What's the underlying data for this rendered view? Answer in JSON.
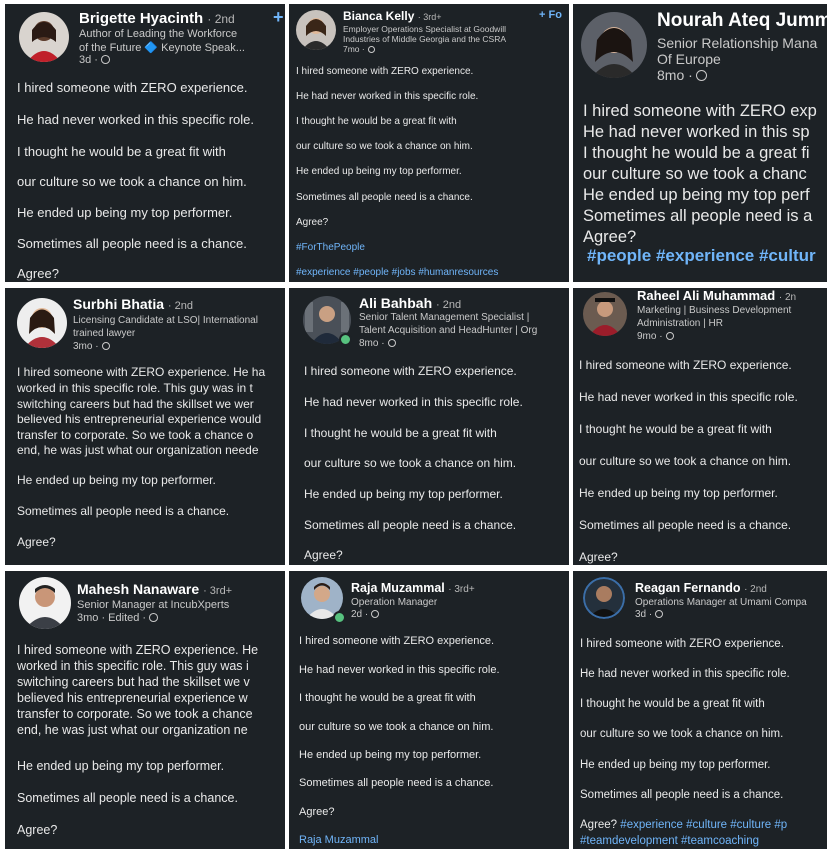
{
  "cards": [
    {
      "name": "Brigette Hyacinth",
      "degree": "· 2nd",
      "headline": [
        "Author of Leading the Workforce",
        "of the Future 🔷 Keynote Speak..."
      ],
      "time": "3d ·",
      "follow": "+",
      "lines": [
        "I hired someone with ZERO experience.",
        "He had never worked in this specific role.",
        "I thought he would be a great fit with",
        "our culture so we took a chance on him.",
        "He ended up being my top performer.",
        "Sometimes all people need is a chance.",
        "Agree?"
      ]
    },
    {
      "name": "Bianca Kelly",
      "degree": "· 3rd+",
      "headline": [
        "Employer Operations Specialist at Goodwill",
        "Industries of Middle Georgia and the CSRA"
      ],
      "time": "7mo ·",
      "follow": "+ Fo",
      "lines": [
        "I hired someone with ZERO experience.",
        "He had never worked in this specific role.",
        "I thought he would be a great fit with",
        "our culture so we took a chance on him.",
        "He ended up being my top performer.",
        "Sometimes all people need is a chance.",
        "Agree?"
      ],
      "hashtags1": "#ForThePeople",
      "hashtags2": "#experience #people #jobs #humanresources"
    },
    {
      "name": "Nourah Ateq Jumm",
      "headline": [
        "Senior Relationship Mana",
        "Of Europe"
      ],
      "time": "8mo ·",
      "lines": [
        "I hired someone with ZERO exp",
        "He had never worked in this sp",
        "I thought he would be a great fi",
        "our culture so we took a chanc",
        "He ended up being my top perf",
        "Sometimes all people need is a",
        "Agree?"
      ],
      "hashtags1": "#people #experience #cultur"
    },
    {
      "name": "Surbhi Bhatia",
      "degree": "· 2nd",
      "headline": [
        "Licensing Candidate at LSO| International",
        "trained lawyer"
      ],
      "time": "3mo ·",
      "lines": [
        "I hired someone with ZERO experience. He ha",
        "worked in this specific role. This guy was in t",
        "switching careers but had the skillset we wer",
        "believed his entrepreneurial experience would",
        "transfer to corporate. So we took a chance o",
        "end, he was just what our organization neede",
        "He ended up being my top performer.",
        "Sometimes all people need is a chance.",
        "Agree?"
      ]
    },
    {
      "name": "Ali Bahbah",
      "degree": "· 2nd",
      "headline": [
        "Senior Talent Management Specialist |",
        "Talent Acquisition and HeadHunter | Org"
      ],
      "time": "8mo ·",
      "lines": [
        "I hired someone with ZERO experience.",
        "He had never worked in this specific role.",
        "I thought he would be a great fit with",
        "our culture so we took a chance on him.",
        "He ended up being my top performer.",
        "Sometimes all people need is a chance.",
        "Agree?"
      ]
    },
    {
      "name": "Raheel Ali Muhammad",
      "degree": "· 2n",
      "headline": [
        "Marketing | Business Development",
        "Administration | HR"
      ],
      "time": "9mo ·",
      "lines": [
        "I hired someone with ZERO experience.",
        "He had never worked in this specific role.",
        "I thought he would be a great fit with",
        "our culture so we took a chance on him.",
        "He ended up being my top performer.",
        "Sometimes all people need is a chance.",
        "Agree?"
      ]
    },
    {
      "name": "Mahesh Nanaware",
      "degree": "· 3rd+",
      "headline": [
        "Senior Manager at IncubXperts"
      ],
      "time": "3mo · Edited ·",
      "lines": [
        "I hired someone with ZERO experience. He",
        "worked in this specific role. This guy was i",
        "switching careers but had the skillset we v",
        "believed his entrepreneurial experience w",
        "transfer to corporate. So we took a chance",
        "end, he was just what our organization ne",
        "He ended up being my top performer.",
        "Sometimes all people need is a chance.",
        "Agree?"
      ]
    },
    {
      "name": "Raja Muzammal",
      "degree": "· 3rd+",
      "headline": [
        "Operation Manager"
      ],
      "time": "2d ·",
      "lines": [
        "I hired someone with ZERO experience.",
        "He had never worked in this specific role.",
        "I thought he would be a great fit with",
        "our culture so we took a chance on him.",
        "He ended up being my top performer.",
        "Sometimes all people need is a chance.",
        "Agree?"
      ],
      "hashtags1": "Raja Muzammal"
    },
    {
      "name": "Reagan Fernando",
      "degree": "· 2nd",
      "headline": [
        "Operations Manager at Umami Compa"
      ],
      "time": "3d ·",
      "lines": [
        "I hired someone with ZERO experience.",
        "He had never worked in this specific role.",
        "I thought he would be a great fit with",
        "our culture so we took a chance on him.",
        "He ended up being my top performer.",
        "Sometimes all people need is a chance.",
        "Agree?"
      ],
      "hashtags1": "#experience #culture #culture #p",
      "hashtags2": "#teamdevelopment #teamcoaching"
    }
  ],
  "colors": {
    "card_bg": "#1d2226",
    "hashtag": "#70b5f9",
    "text": "#e9e9e9"
  }
}
